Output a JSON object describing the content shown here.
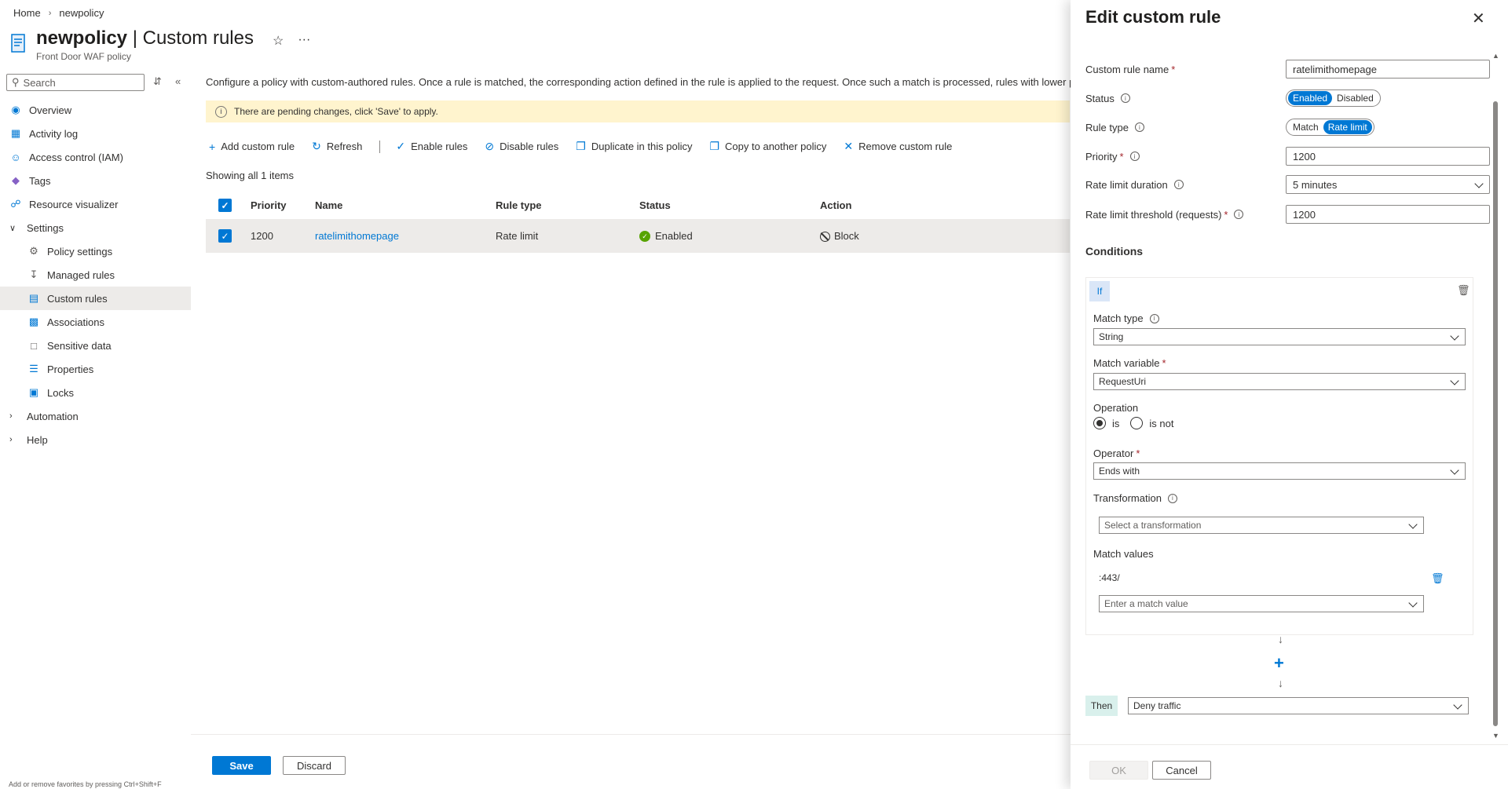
{
  "breadcrumb": {
    "home": "Home",
    "current": "newpolicy"
  },
  "header": {
    "resource": "newpolicy",
    "separator": " | ",
    "page": "Custom rules",
    "subtitle": "Front Door WAF policy",
    "star_icon": "star-icon",
    "more": "···"
  },
  "search": {
    "placeholder": "Search"
  },
  "nav": {
    "overview": "Overview",
    "activity_log": "Activity log",
    "iam": "Access control (IAM)",
    "tags": "Tags",
    "resource_visualizer": "Resource visualizer",
    "settings": "Settings",
    "policy_settings": "Policy settings",
    "managed_rules": "Managed rules",
    "custom_rules": "Custom rules",
    "associations": "Associations",
    "sensitive_data": "Sensitive data",
    "properties": "Properties",
    "locks": "Locks",
    "automation": "Automation",
    "help": "Help"
  },
  "fav_hint": "Add or remove favorites by pressing Ctrl+Shift+F",
  "main": {
    "description": "Configure a policy with custom-authored rules. Once a rule is matched, the corresponding action defined in the rule is applied to the request. Once such a match is processed, rules with lower priorities are",
    "pending": "There are pending changes, click 'Save' to apply.",
    "toolbar": {
      "add": "Add custom rule",
      "refresh": "Refresh",
      "enable": "Enable rules",
      "disable": "Disable rules",
      "duplicate": "Duplicate in this policy",
      "copy": "Copy to another policy",
      "remove": "Remove custom rule"
    },
    "showing": "Showing all 1 items",
    "columns": {
      "priority": "Priority",
      "name": "Name",
      "rule_type": "Rule type",
      "status": "Status",
      "action": "Action"
    },
    "rows": [
      {
        "priority": "1200",
        "name": "ratelimithomepage",
        "rule_type": "Rate limit",
        "status": "Enabled",
        "action": "Block"
      }
    ],
    "save": "Save",
    "discard": "Discard"
  },
  "panel": {
    "title": "Edit custom rule",
    "name_label": "Custom rule name",
    "name_value": "ratelimithomepage",
    "status_label": "Status",
    "status_on": "Enabled",
    "status_off": "Disabled",
    "ruletype_label": "Rule type",
    "ruletype_match": "Match",
    "ruletype_rate": "Rate limit",
    "priority_label": "Priority",
    "priority_value": "1200",
    "duration_label": "Rate limit duration",
    "duration_value": "5 minutes",
    "threshold_label": "Rate limit threshold (requests)",
    "threshold_value": "1200",
    "conditions": "Conditions",
    "if": "If",
    "match_type_label": "Match type",
    "match_type_value": "String",
    "match_var_label": "Match variable",
    "match_var_value": "RequestUri",
    "operation_label": "Operation",
    "op_is": "is",
    "op_is_not": "is not",
    "operator_label": "Operator",
    "operator_value": "Ends with",
    "transformation_label": "Transformation",
    "transformation_placeholder": "Select a transformation",
    "match_values_label": "Match values",
    "match_value_1": ":443/",
    "match_value_placeholder": "Enter a match value",
    "then": "Then",
    "then_value": "Deny traffic",
    "ok": "OK",
    "cancel": "Cancel"
  },
  "colors": {
    "accent": "#0078d4",
    "warning_bg": "#fff4ce",
    "selected_bg": "#edebe9",
    "success": "#57a300"
  }
}
